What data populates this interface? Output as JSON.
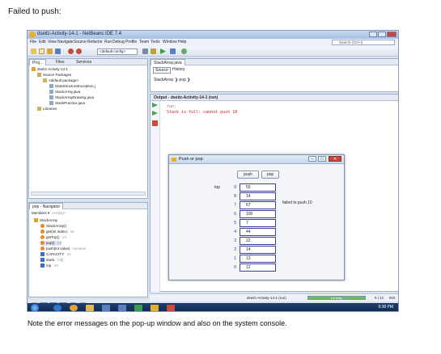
{
  "doc": {
    "caption_top": "Failed to push:",
    "caption_bottom": "Note the error messages on the pop-up window and also on the system console."
  },
  "window": {
    "title": "dseitz-Activity-14-1 - NetBeans IDE 7.4"
  },
  "menu": [
    "File",
    "Edit",
    "View",
    "Navigate",
    "Source",
    "Refactor",
    "Run",
    "Debug",
    "Profile",
    "Team",
    "Tools",
    "Window",
    "Help"
  ],
  "search": {
    "placeholder": "Search (Ctrl+I)"
  },
  "toolbar": {
    "config": "<default config>"
  },
  "projects": {
    "tabs": [
      "Proj...",
      "Files",
      "Services"
    ],
    "tree": [
      "dseitz-Activity-14-1",
      "Source Packages",
      "<default package>",
      "DataStructureException.j",
      "StackArray.java",
      "StackArrayDrawing.java",
      "StackPractice.java",
      "Libraries"
    ]
  },
  "navigator": {
    "title": "pop - Navigator",
    "members_label": "Members",
    "filter": "<empty>",
    "items": [
      {
        "name": "StackArray",
        "type": ""
      },
      {
        "name": "StackArray()",
        "type": ""
      },
      {
        "name": "get(int index)",
        "type": " : int"
      },
      {
        "name": "getTop()",
        "type": " : int"
      },
      {
        "name": "pop()",
        "type": " : int"
      },
      {
        "name": "push(int value)",
        "type": " : boolean"
      },
      {
        "name": "CAPACITY",
        "type": " : int"
      },
      {
        "name": "stack",
        "type": " : int[]"
      },
      {
        "name": "top",
        "type": " : int"
      }
    ]
  },
  "editor": {
    "tab": "StackArray.java",
    "source_btn": "Source",
    "history_btn": "History",
    "crumb_class": "StackArray",
    "crumb_method": "pop"
  },
  "output": {
    "title": "Output - dseitz-Activity-14-1 (run)",
    "lines": [
      "run:",
      "Stack is full: cannot push 10"
    ]
  },
  "dialog": {
    "title": "Push or pop",
    "push_label": "push",
    "pop_label": "pop",
    "top_label": "top",
    "message": "failed to push 10",
    "stack": [
      {
        "index": "9",
        "value": "55"
      },
      {
        "index": "8",
        "value": "14"
      },
      {
        "index": "7",
        "value": "67"
      },
      {
        "index": "6",
        "value": "100"
      },
      {
        "index": "5",
        "value": "7"
      },
      {
        "index": "4",
        "value": "44"
      },
      {
        "index": "3",
        "value": "22"
      },
      {
        "index": "2",
        "value": "14"
      },
      {
        "index": "1",
        "value": "13"
      },
      {
        "index": "0",
        "value": "12"
      }
    ]
  },
  "status": {
    "run_label": "dseitz-Activity-14-1 (run)",
    "progress_text": "running...",
    "position": "9 | 14",
    "mode": "INS"
  },
  "taskbar": {
    "time": "9:38 PM"
  }
}
